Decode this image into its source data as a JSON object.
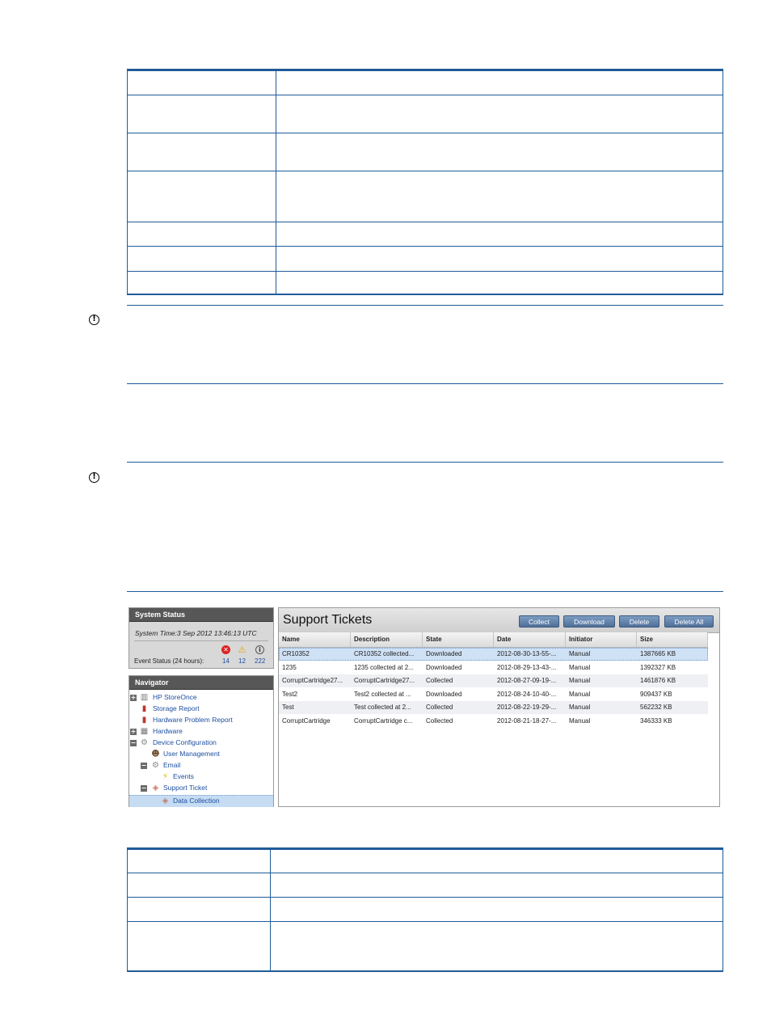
{
  "screenshot": {
    "system_status": {
      "header": "System Status",
      "system_time": "System Time:3 Sep 2012 13:46:13 UTC",
      "event_status_label": "Event Status (24 hours):",
      "error_count": "14",
      "warning_count": "12",
      "info_count": "222"
    },
    "navigator": {
      "header": "Navigator",
      "items": [
        {
          "label": "HP StoreOnce",
          "expander": "+"
        },
        {
          "label": "Storage Report"
        },
        {
          "label": "Hardware Problem Report"
        },
        {
          "label": "Hardware",
          "expander": "+"
        },
        {
          "label": "Device Configuration",
          "expander": "−"
        },
        {
          "label": "User Management"
        },
        {
          "label": "Email",
          "expander": "−"
        },
        {
          "label": "Events"
        },
        {
          "label": "Support Ticket",
          "expander": "−"
        },
        {
          "label": "Data Collection",
          "selected": true
        }
      ]
    },
    "support_tickets": {
      "title": "Support Tickets",
      "buttons": {
        "collect": "Collect",
        "download": "Download",
        "delete": "Delete",
        "delete_all": "Delete All"
      },
      "columns": [
        "Name",
        "Description",
        "State",
        "Date",
        "Initiator",
        "Size"
      ],
      "rows": [
        [
          "CR10352",
          "CR10352 collected...",
          "Downloaded",
          "2012-08-30-13-55-...",
          "Manual",
          "1387665 KB"
        ],
        [
          "1235",
          "1235 collected at 2...",
          "Downloaded",
          "2012-08-29-13-43-...",
          "Manual",
          "1392327 KB"
        ],
        [
          "CorruptCartridge27...",
          "CorruptCartridge27...",
          "Collected",
          "2012-08-27-09-19-...",
          "Manual",
          "1461876 KB"
        ],
        [
          "Test2",
          "Test2 collected at ...",
          "Downloaded",
          "2012-08-24-10-40-...",
          "Manual",
          "909437 KB"
        ],
        [
          "Test",
          "Test collected at 2...",
          "Collected",
          "2012-08-22-19-29-...",
          "Manual",
          "562232 KB"
        ],
        [
          "CorruptCartridge",
          "CorruptCartridge c...",
          "Collected",
          "2012-08-21-18-27-...",
          "Manual",
          "346333 KB"
        ]
      ]
    }
  }
}
